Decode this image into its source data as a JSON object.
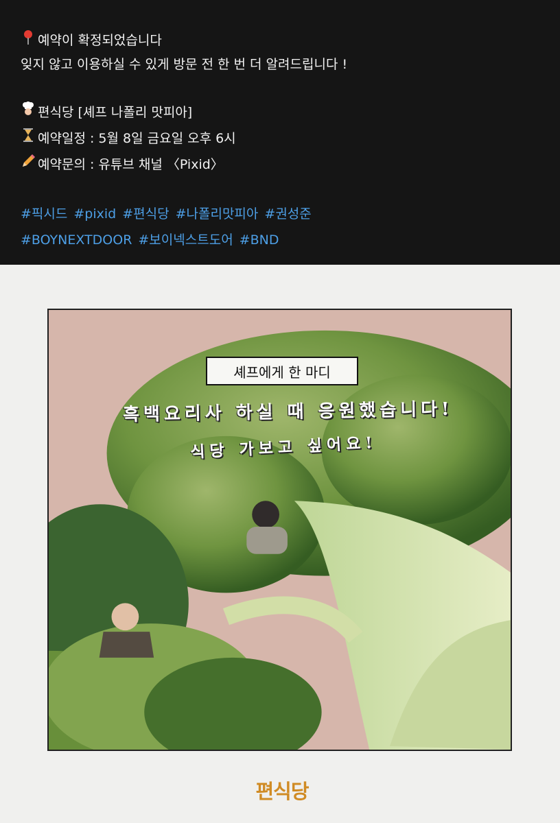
{
  "post": {
    "line1_icon": "round-pushpin-icon",
    "line1": "예약이 확정되었습니다",
    "line2": "잊지 않고 이용하실 수 있게 방문 전 한 번 더 알려드립니다 !",
    "restaurant_icon": "chef-icon",
    "restaurant": "편식당 [셰프 나폴리 맛피아]",
    "schedule_icon": "hourglass-icon",
    "schedule": "예약일정 : 5월 8일 금요일 오후 6시",
    "contact_icon": "pencil-icon",
    "contact": "예약문의 : 유튜브 채널 〈Pixid〉",
    "hashtags_line1": [
      "#픽시드",
      "#pixid",
      "#편식당",
      "#나폴리맛피아",
      "#권성준"
    ],
    "hashtags_line2": [
      "#BOYNEXTDOOR",
      "#보이넥스트도어",
      "#BND"
    ]
  },
  "image": {
    "caption": "셰프에게 한 마디",
    "handwriting_line1": "흑백요리사 하실 때 응원했습니다!",
    "handwriting_line2": "식당 가보고 싶어요!"
  },
  "logo": {
    "text": "편식당"
  },
  "colors": {
    "post_background": "#151515",
    "post_text": "#f2f2f2",
    "hashtag": "#4d9fe6",
    "page_background": "#f0f0ee",
    "broccoli": "#6f9440"
  }
}
